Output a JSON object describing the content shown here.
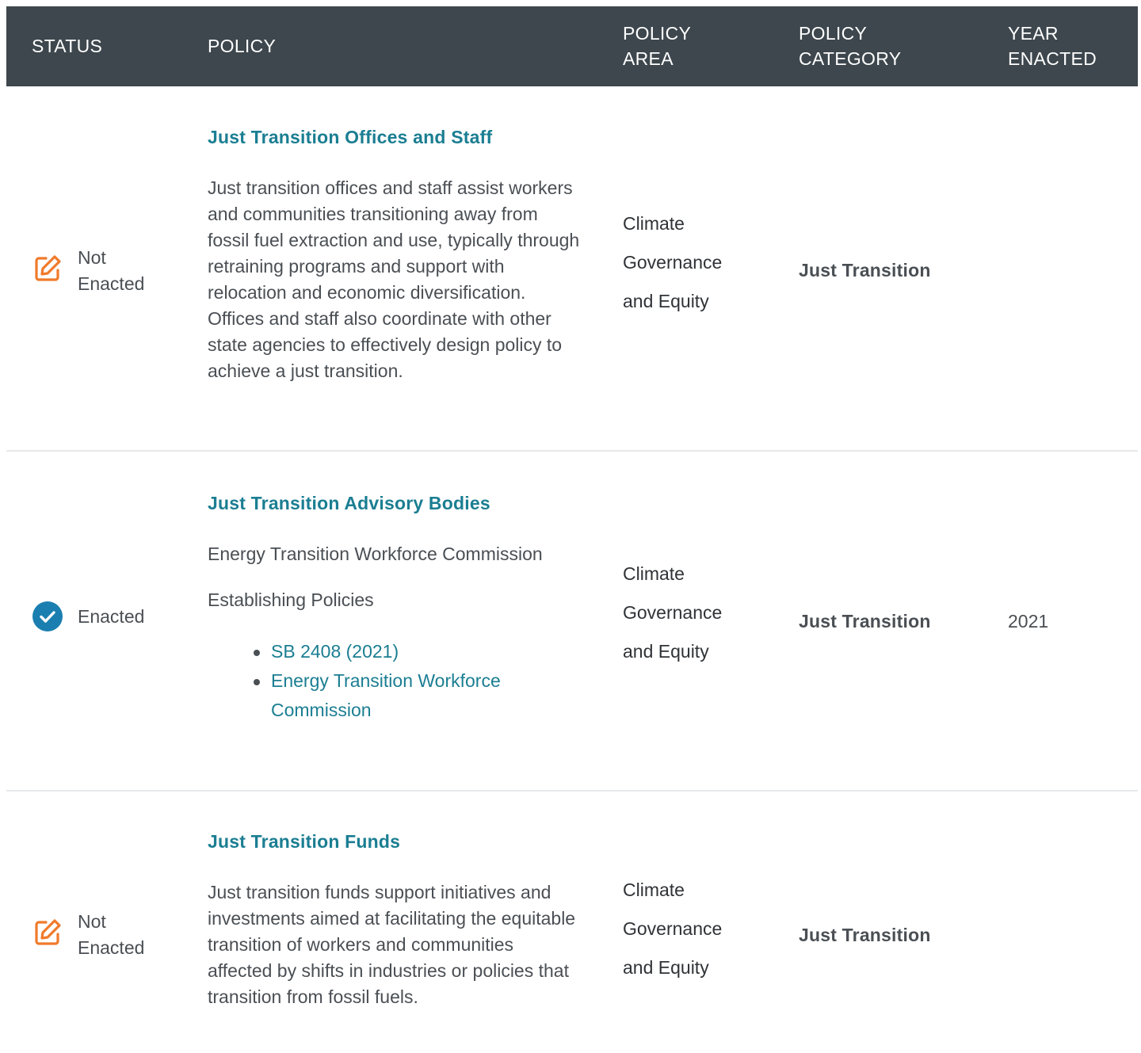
{
  "headers": {
    "status": "STATUS",
    "policy": "POLICY",
    "area_line1": "POLICY",
    "area_line2": "AREA",
    "category_line1": "POLICY",
    "category_line2": "CATEGORY",
    "year_line1": "YEAR",
    "year_line2": "ENACTED"
  },
  "colors": {
    "header_bg": "#3d474d",
    "link": "#1b7e92",
    "not_enacted_icon": "#f07a2a",
    "enacted_icon": "#1a7fb0"
  },
  "rows": [
    {
      "status_icon": "edit-icon",
      "status_line1": "Not",
      "status_line2": "Enacted",
      "title": "Just Transition Offices and Staff",
      "description": "Just transition offices and staff assist workers and communities transitioning away from fossil fuel extraction and use, typically through retraining programs and support with relocation and economic diversification. Offices and staff also coordinate with other state agencies to effectively design policy to achieve a just transition.",
      "area_line1": "Climate",
      "area_line2": "Governance",
      "area_line3": "and Equity",
      "category": "Just Transition",
      "year": ""
    },
    {
      "status_icon": "check-circle-icon",
      "status_line1": "Enacted",
      "title": "Just Transition Advisory Bodies",
      "sub_name": "Energy Transition Workforce Commission",
      "est_label": "Establishing Policies",
      "links": [
        "SB 2408 (2021)",
        "Energy Transition Workforce Commission"
      ],
      "area_line1": "Climate",
      "area_line2": "Governance",
      "area_line3": "and Equity",
      "category": "Just Transition",
      "year": "2021"
    },
    {
      "status_icon": "edit-icon",
      "status_line1": "Not",
      "status_line2": "Enacted",
      "title": "Just Transition Funds",
      "description": "Just transition funds support initiatives and investments aimed at facilitating the equitable transition of workers and communities affected by shifts in industries or policies that transition from fossil fuels.",
      "area_line1": "Climate",
      "area_line2": "Governance",
      "area_line3": "and Equity",
      "category": "Just Transition",
      "year": ""
    }
  ]
}
